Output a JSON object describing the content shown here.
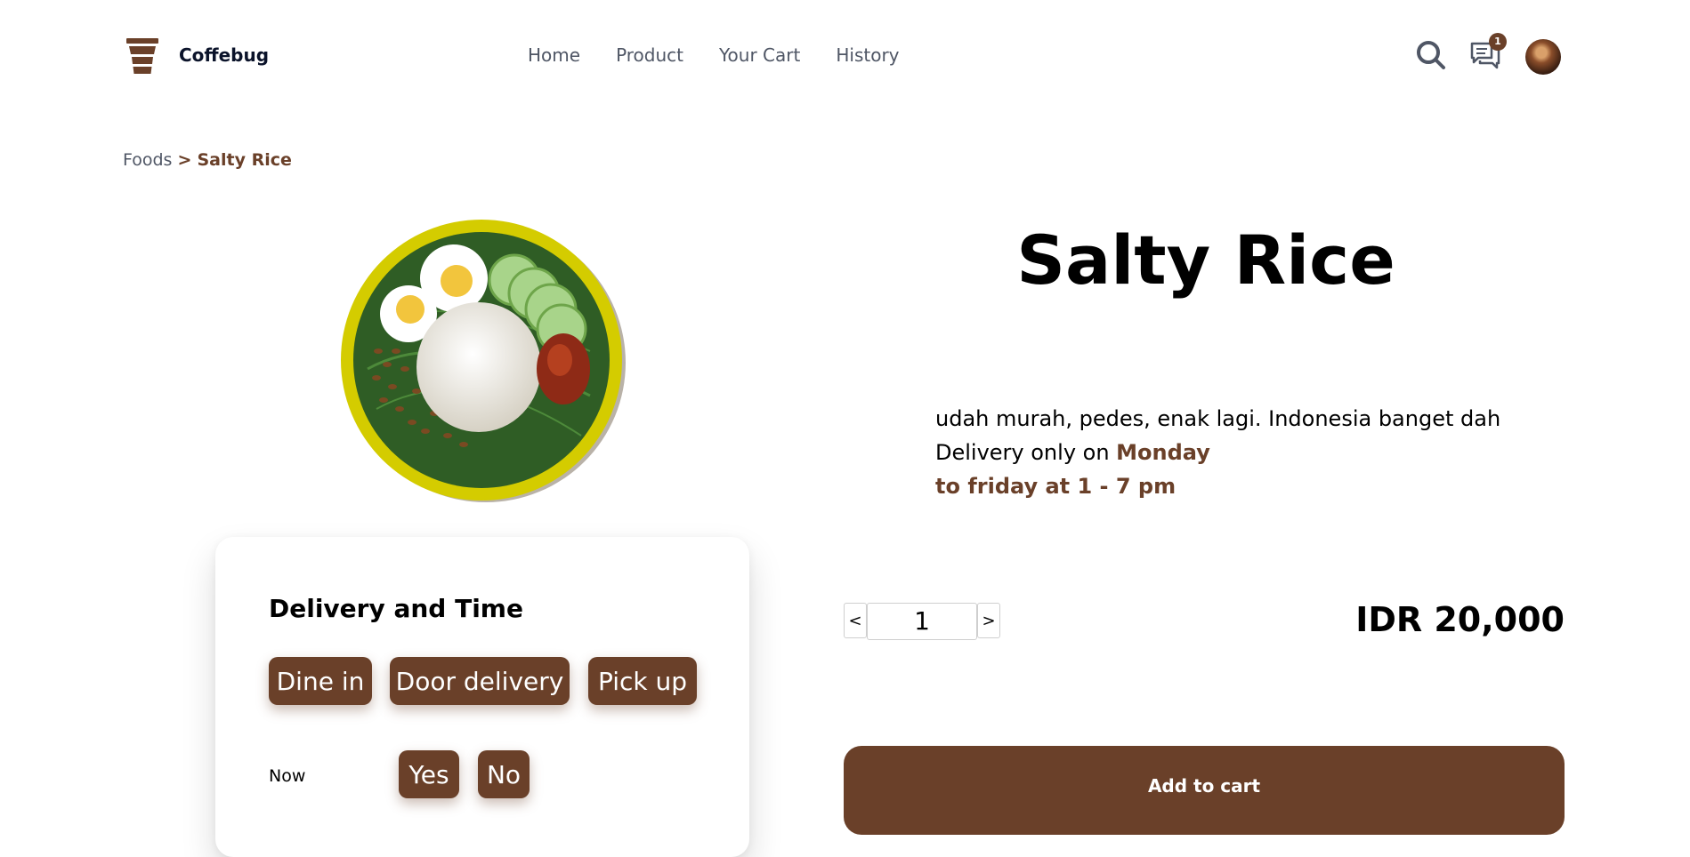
{
  "brand": {
    "name": "Coffebug",
    "logo_icon": "coffee-cup-icon"
  },
  "nav": {
    "items": [
      "Home",
      "Product",
      "Your Cart",
      "History"
    ]
  },
  "header_icons": {
    "search": "search-icon",
    "chat": "chat-icon",
    "chat_badge": "1",
    "avatar": "user-avatar"
  },
  "breadcrumb": {
    "parent": "Foods",
    "separator": ">",
    "current": "Salty Rice"
  },
  "product": {
    "title": "Salty Rice",
    "description": "udah murah, pedes, enak lagi. Indonesia banget dah",
    "delivery_prefix": "Delivery only on ",
    "delivery_day": "Monday",
    "delivery_time": "to friday at 1 - 7 pm",
    "price": "IDR 20,000",
    "quantity": "1",
    "dec_label": "<",
    "inc_label": ">",
    "add_to_cart": "Add to cart"
  },
  "delivery_card": {
    "title": "Delivery and Time",
    "options": [
      "Dine in",
      "Door delivery",
      "Pick up"
    ],
    "now_label": "Now",
    "now_options": [
      "Yes",
      "No"
    ]
  },
  "colors": {
    "brand_brown": "#6a4029",
    "nav_gray": "#4f5665",
    "plate_yellow": "#d4cc00"
  }
}
